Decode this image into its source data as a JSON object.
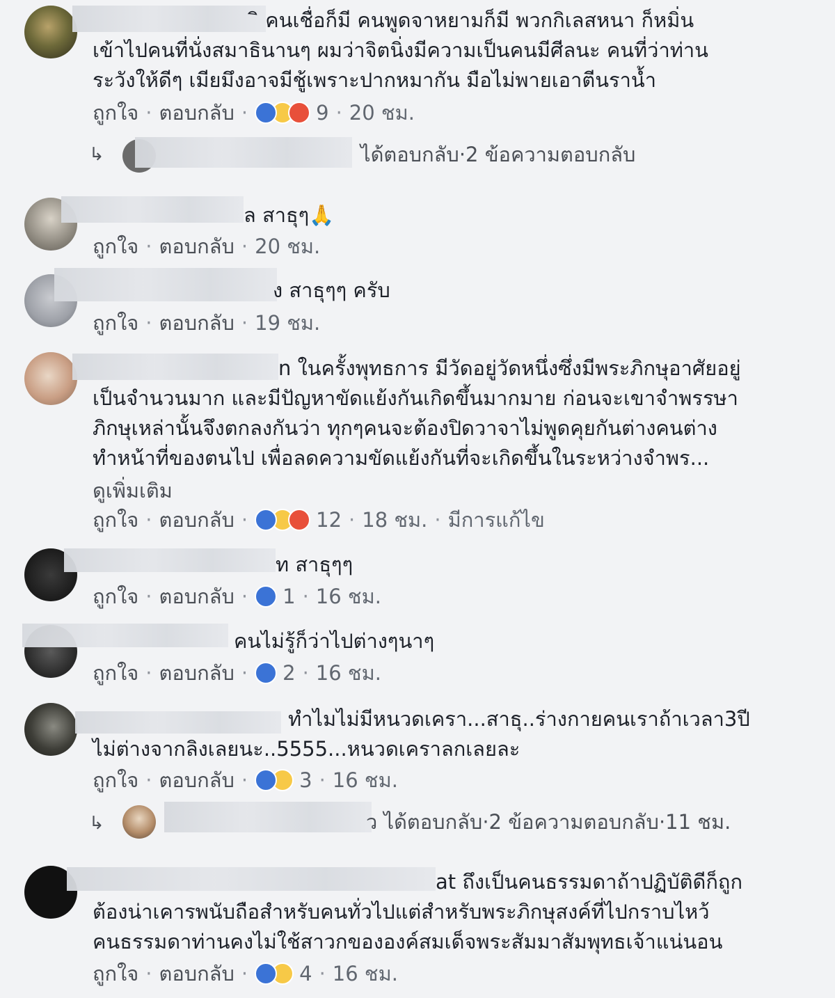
{
  "actions": {
    "like": "ถูกใจ",
    "reply": "ตอบกลับ",
    "sep": "·"
  },
  "comments": [
    {
      "lines": [
        "ิ คนเชื่อก็มี คนพูดจาหยามก็มี พวกกิเลสหนา ก็หมิ่น",
        "เข้าไปคนที่นั่งสมาธินานๆ ผมว่าจิตนิ่งมีความเป็นคนมีศีลนะ คนที่ว่าท่าน",
        "ระวังให้ดีๆ เมียมึงอาจมีชู้เพราะปากหมากัน มือไม่พายเอาตีนราน้ำ"
      ],
      "count": "9",
      "time": "20 ชม.",
      "reply_summary": {
        "text": "ได้ตอบกลับ",
        "count": "2 ข้อความตอบกลับ"
      }
    },
    {
      "lines": [
        "ล สาธุๆ🙏"
      ],
      "time": "20 ชม."
    },
    {
      "lines": [
        "ง สาธุๆๆ ครับ"
      ],
      "time": "19 ชม."
    },
    {
      "lines": [
        "n ในครั้งพุทธการ มีวัดอยู่วัดหนึ่งซึ่งมีพระภิกษุอาศัยอยู่",
        "เป็นจำนวนมาก และมีปัญหาขัดแย้งกันเกิดขึ้นมากมาย ก่อนจะเขาจำพรรษา",
        "ภิกษุเหล่านั้นจึงตกลงกันว่า ทุกๆคนจะต้องปิดวาจาไม่พูดคุยกันต่างคนต่าง",
        "ทำหน้าที่ของตนไป เพื่อลดความขัดแย้งกันที่จะเกิดขึ้นในระหว่างจำพร..."
      ],
      "see_more": "ดูเพิ่มเติม",
      "count": "12",
      "time": "18 ชม.",
      "edited": "มีการแก้ไข"
    },
    {
      "lines": [
        "ท สาธุๆๆ"
      ],
      "count": "1",
      "time": "16 ชม."
    },
    {
      "lines": [
        "คนไม่รู้ก็ว่าไปต่างๆนาๆ"
      ],
      "count": "2",
      "time": "16 ชม."
    },
    {
      "lines": [
        "ทำไมไม่มีหนวดเครา...สาธุ..ร่างกายคนเราถ้าเวลา3ปี",
        "ไม่ต่างจากลิงเลยนะ..5555...หนวดเคราลกเลยละ"
      ],
      "count": "3",
      "time": "16 ชม.",
      "reply_summary": {
        "text": "ว ได้ตอบกลับ",
        "count": "2 ข้อความตอบกลับ",
        "time": "11 ชม."
      }
    },
    {
      "lines": [
        "at ถึงเป็นคนธรรมดาถ้าปฏิบัติดีก็ถูก",
        "ต้องน่าเคารพนับถือสำหรับคนทั่วไปแต่สำหรับพระภิกษุสงค์ที่ไปกราบไหว้",
        "คนธรรมดาท่านคงไม่ใช้สาวกขององค์สมเด็จพระสัมมาสัมพุทธเจ้าแน่นอน"
      ],
      "count": "4",
      "time": "16 ชม."
    }
  ]
}
